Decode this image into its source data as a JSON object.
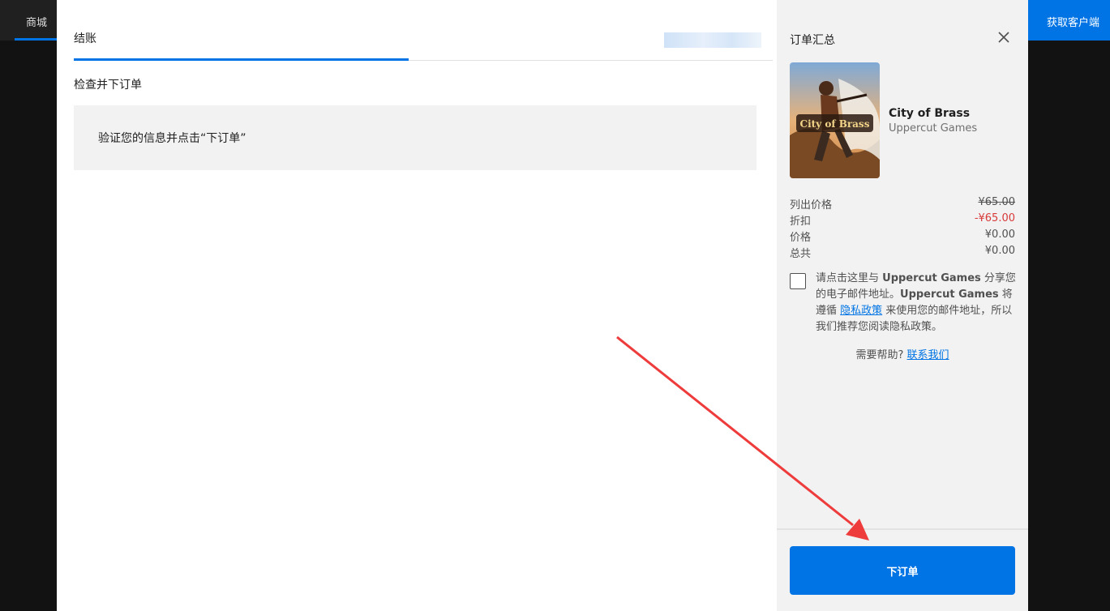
{
  "topbar": {
    "store_label": "商城",
    "client_label": "获取客户端"
  },
  "checkout": {
    "tab_title": "结账",
    "section_title": "检查并下订单",
    "notice": "验证您的信息并点击“下订单”"
  },
  "summary": {
    "title": "订单汇总",
    "product": {
      "name": "City of Brass",
      "publisher": "Uppercut Games",
      "art_text": "City of Brass"
    },
    "prices": [
      {
        "label": "列出价格",
        "value": "¥65.00"
      },
      {
        "label": "折扣",
        "value": "-¥65.00"
      },
      {
        "label": "价格",
        "value": "¥0.00"
      },
      {
        "label": "总共",
        "value": "¥0.00"
      }
    ],
    "consent": {
      "part1": "请点击这里与 ",
      "publisher": "Uppercut Games",
      "part2": " 分享您的电子邮件地址。",
      "part3": " 将遵循 ",
      "privacy_link": "隐私政策",
      "part4": " 来使用您的邮件地址，所以我们推荐您阅读隐私政策。"
    },
    "help": {
      "text": "需要帮助? ",
      "link": "联系我们"
    },
    "order_button": "下订单"
  },
  "colors": {
    "accent": "#0074e4",
    "discount": "#d83a3a",
    "annotation_arrow": "#ee3b3b"
  }
}
